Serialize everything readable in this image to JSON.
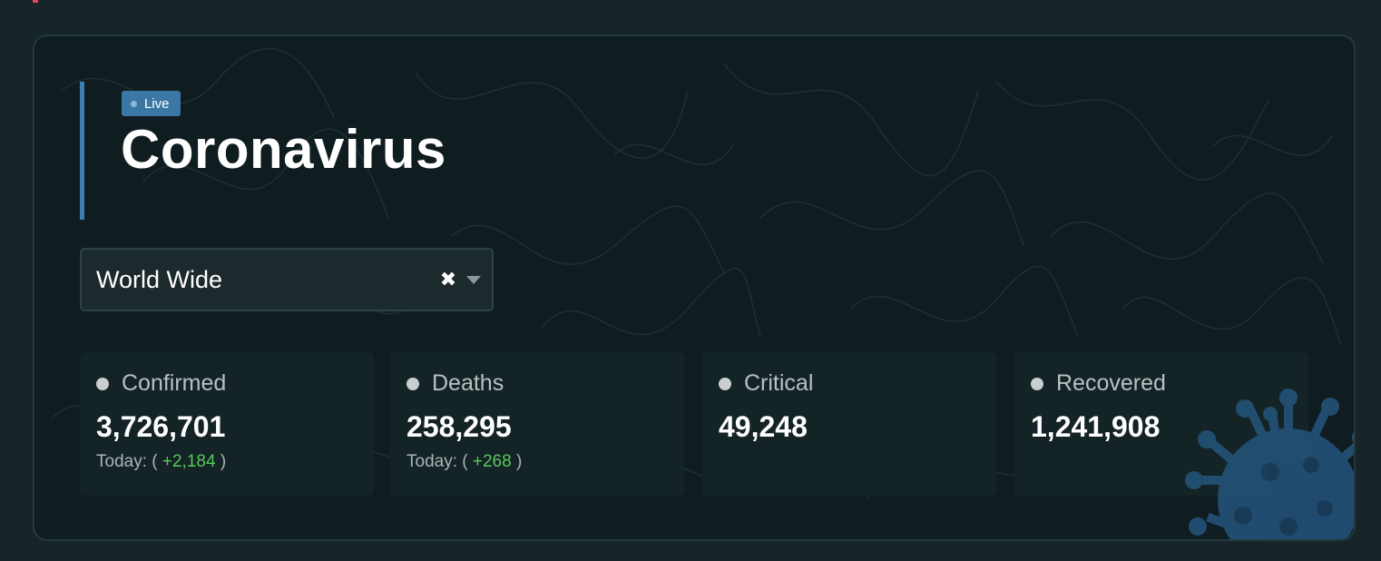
{
  "header": {
    "badge_label": "Live",
    "title": "Coronavirus"
  },
  "selector": {
    "value": "World Wide",
    "clear_symbol": "✖",
    "icons": [
      "clear-icon",
      "chevron-down-icon"
    ]
  },
  "stats": [
    {
      "label": "Confirmed",
      "value": "3,726,701",
      "today_prefix": "Today: (",
      "today_delta": "+2,184",
      "today_suffix": ")"
    },
    {
      "label": "Deaths",
      "value": "258,295",
      "today_prefix": "Today: (",
      "today_delta": "+268",
      "today_suffix": ")"
    },
    {
      "label": "Critical",
      "value": "49,248"
    },
    {
      "label": "Recovered",
      "value": "1,241,908"
    }
  ],
  "colors": {
    "page_background": "#17242a",
    "card_background": "#0f1c20",
    "accent": "#3a77a5",
    "delta_positive": "#57c85b",
    "virus_illustration": "#235278"
  },
  "decor": {
    "illustration": "virus-icon",
    "background_pattern": "squiggle-lines"
  }
}
